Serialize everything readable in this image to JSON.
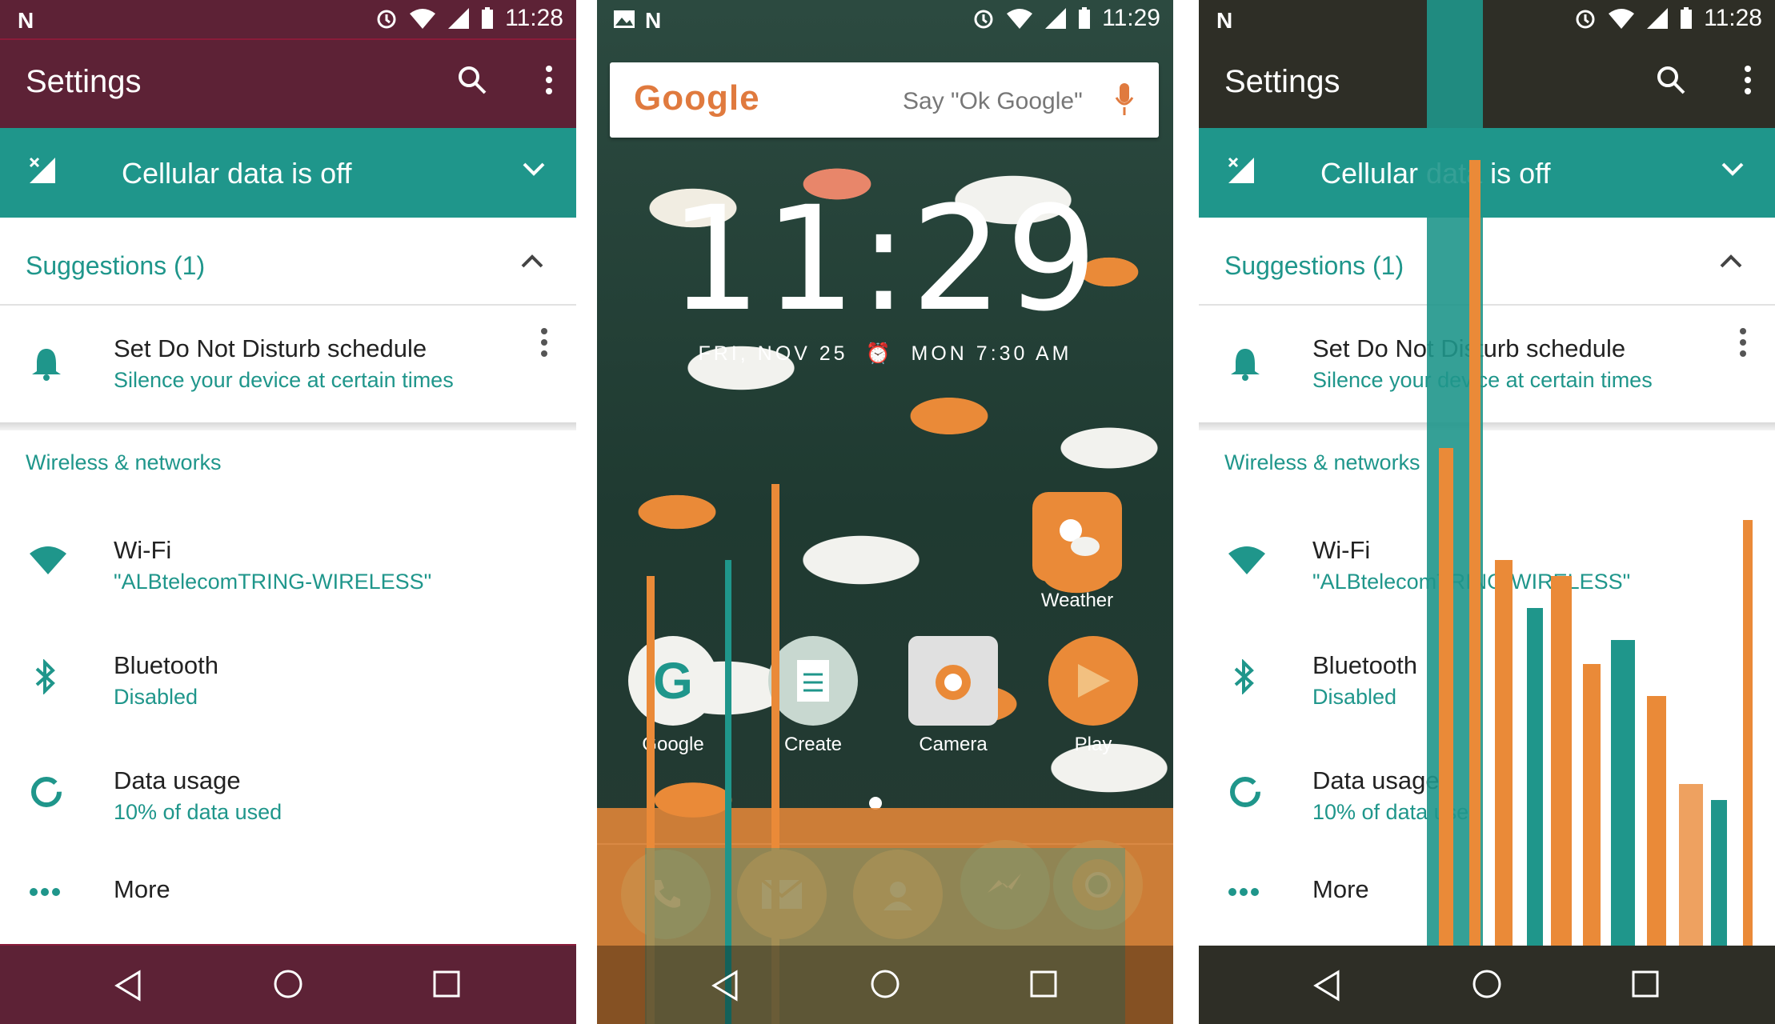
{
  "status": {
    "time_left": "11:28",
    "time_mid": "11:29",
    "time_right": "11:28"
  },
  "settings": {
    "title": "Settings",
    "condition": "Cellular data is off",
    "suggestions_title": "Suggestions (1)",
    "suggestion": {
      "title": "Set Do Not Disturb schedule",
      "subtitle": "Silence your device at certain times"
    },
    "category": "Wireless & networks",
    "items": [
      {
        "title": "Wi-Fi",
        "subtitle": "\"ALBtelecomTRING-WIRELESS\""
      },
      {
        "title": "Bluetooth",
        "subtitle": "Disabled"
      },
      {
        "title": "Data usage",
        "subtitle": "10% of data used"
      },
      {
        "title": "More",
        "subtitle": ""
      }
    ]
  },
  "home": {
    "search_logo": "Google",
    "search_hint": "Say \"Ok Google\"",
    "clock": "11:29",
    "date": "FRI, NOV 25",
    "alarm": "MON 7:30 AM",
    "apps": [
      {
        "label": "Weather"
      },
      {
        "label": "Google"
      },
      {
        "label": "Create"
      },
      {
        "label": "Camera"
      },
      {
        "label": "Play"
      }
    ]
  },
  "colors": {
    "teal": "#1f968b",
    "dark": "#2e2e26",
    "orange": "#ea8a38"
  }
}
